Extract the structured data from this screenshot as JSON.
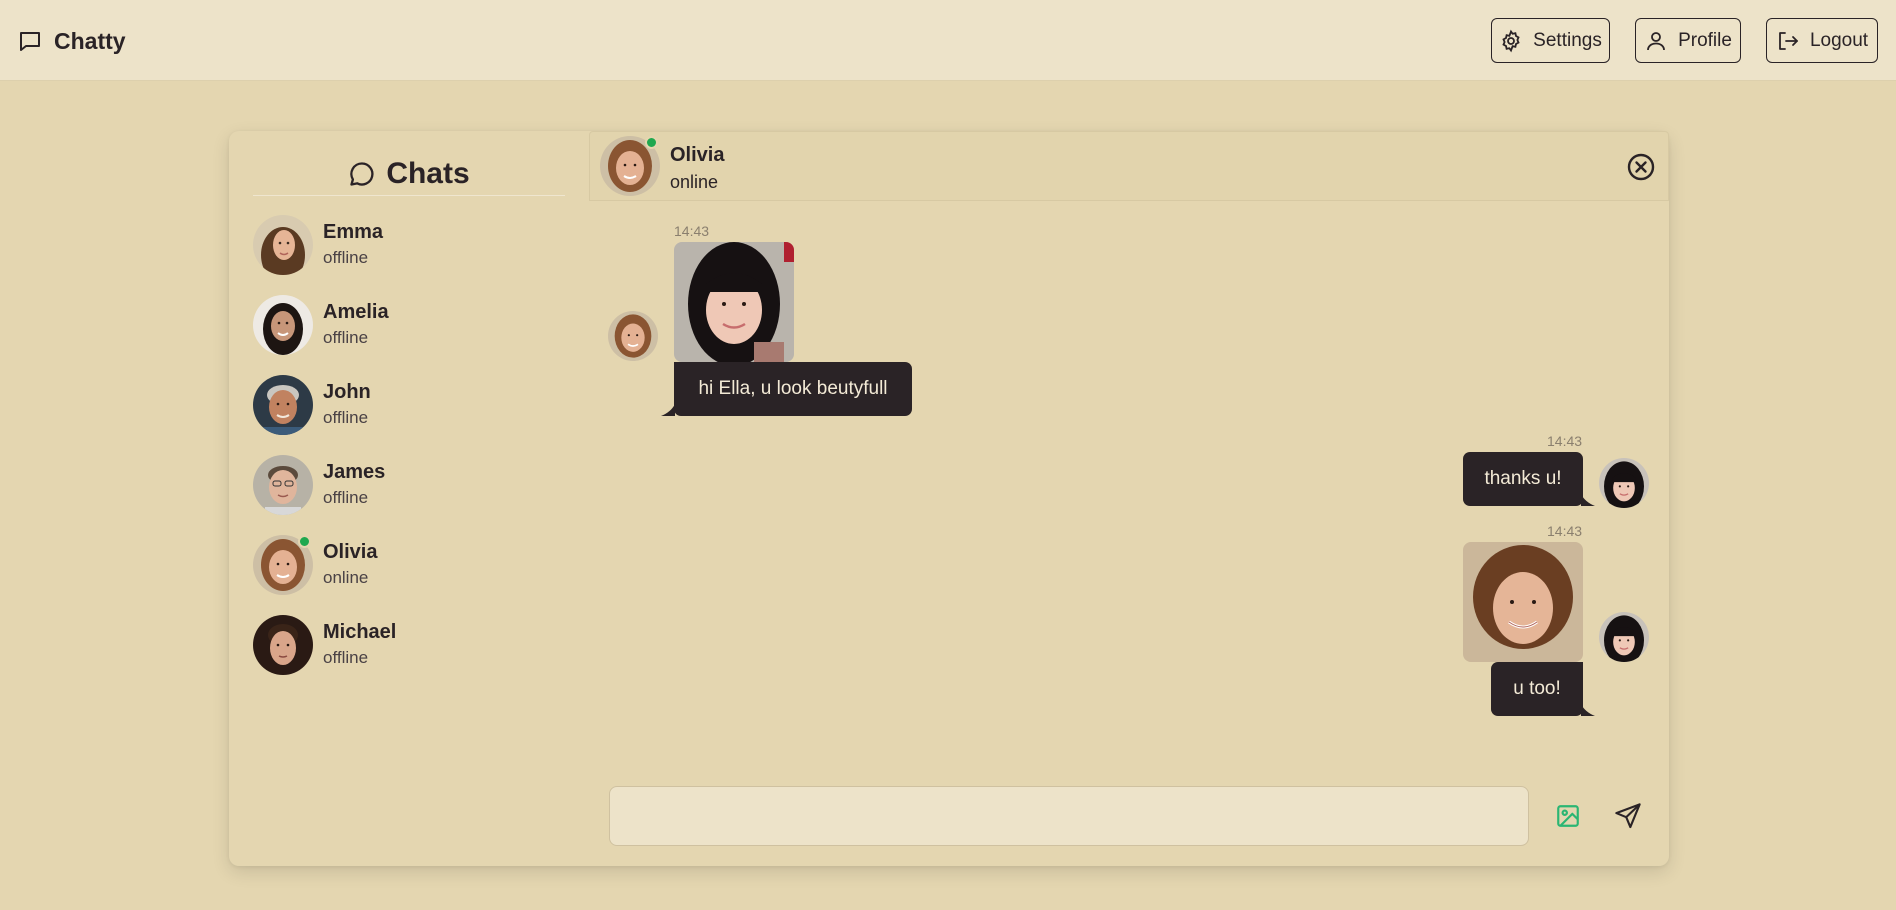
{
  "app": {
    "name": "Chatty"
  },
  "nav": {
    "settings_label": "Settings",
    "profile_label": "Profile",
    "logout_label": "Logout"
  },
  "sidebar": {
    "title": "Chats",
    "contacts": [
      {
        "name": "Emma",
        "status": "offline"
      },
      {
        "name": "Amelia",
        "status": "offline"
      },
      {
        "name": "John",
        "status": "offline"
      },
      {
        "name": "James",
        "status": "offline"
      },
      {
        "name": "Olivia",
        "status": "online"
      },
      {
        "name": "Michael",
        "status": "offline"
      }
    ]
  },
  "chat": {
    "contact_name": "Olivia",
    "contact_status": "online",
    "messages": [
      {
        "time": "14:43",
        "text": "hi Ella, u look beutyfull",
        "has_image": true,
        "outgoing": false
      },
      {
        "time": "14:43",
        "text": "thanks u!",
        "has_image": false,
        "outgoing": true
      },
      {
        "time": "14:43",
        "text": "u too!",
        "has_image": true,
        "outgoing": true
      }
    ]
  },
  "composer": {
    "value": "",
    "placeholder": ""
  },
  "colors": {
    "background": "#e4d6b0",
    "topbar": "#ede3c9",
    "bubble": "#2a2326",
    "online": "#1fa84f",
    "image_icon": "#2bb673"
  }
}
